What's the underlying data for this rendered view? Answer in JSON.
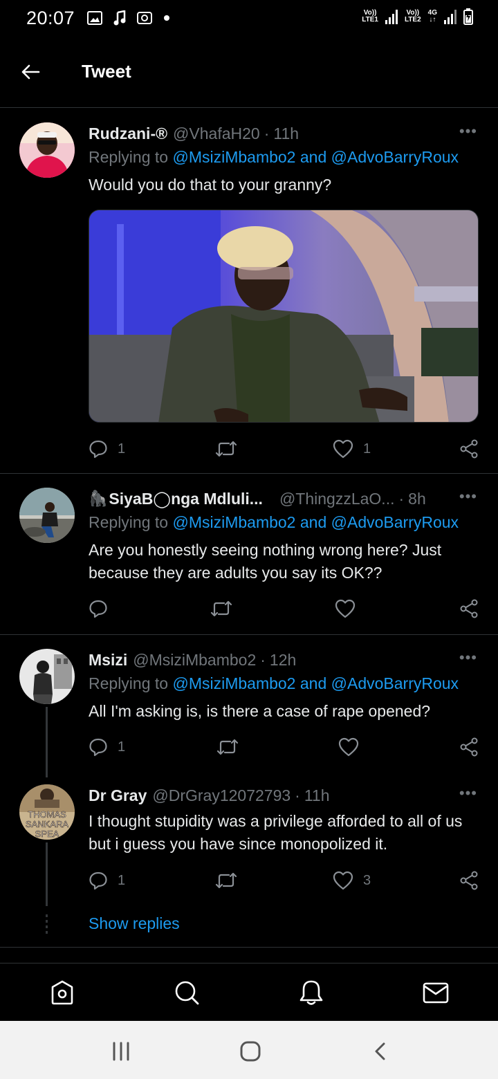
{
  "status_bar": {
    "time": "20:07",
    "sim1_label_top": "Vo))",
    "sim1_label_bottom": "LTE1",
    "sim2_label_top": "Vo))",
    "sim2_label_bottom": "LTE2",
    "network": "4G"
  },
  "header": {
    "title": "Tweet"
  },
  "tweets": [
    {
      "name": "Rudzani-®",
      "handle": "@VhafaH20",
      "time": "11h",
      "replying_prefix": "Replying to",
      "mention1": "@MsiziMbambo2",
      "and": "and",
      "mention2": "@AdvoBarryRoux",
      "text": "Would you do that to your granny?",
      "reply_count": "1",
      "retweet_count": "",
      "like_count": "1"
    },
    {
      "name": "SiyaB◯nga Mdluli...",
      "emoji": "🦍",
      "handle": "@ThingzzLaO...",
      "time": "8h",
      "replying_prefix": "Replying to",
      "mention1": "@MsiziMbambo2",
      "and": "and",
      "mention2": "@AdvoBarryRoux",
      "text": "Are you honestly seeing nothing wrong here? Just because they are adults you say its OK??",
      "reply_count": "",
      "retweet_count": "",
      "like_count": ""
    },
    {
      "name": "Msizi",
      "handle": "@MsiziMbambo2",
      "time": "12h",
      "replying_prefix": "Replying to",
      "mention1": "@MsiziMbambo2",
      "and": "and",
      "mention2": "@AdvoBarryRoux",
      "text": "All I'm asking is, is there a case of rape opened?",
      "reply_count": "1",
      "retweet_count": "",
      "like_count": ""
    },
    {
      "name": "Dr Gray",
      "handle": "@DrGray12072793",
      "time": "11h",
      "text": "I thought stupidity was a privilege afforded to all of us but i guess you have since monopolized it.",
      "avatar_text": "THOMAS SANKARA SPEA",
      "reply_count": "1",
      "retweet_count": "",
      "like_count": "3"
    }
  ],
  "show_replies": "Show replies",
  "more_glyph": "•••",
  "dot_sep": "·",
  "icons": {
    "back": "arrow-left-icon",
    "reply": "reply-bubble-icon",
    "retweet": "retweet-icon",
    "like": "heart-icon",
    "share": "share-icon",
    "home": "home-icon",
    "search": "search-icon",
    "notifications": "bell-icon",
    "messages": "mail-icon"
  },
  "colors": {
    "accent": "#1d9bf0",
    "muted": "#71767b",
    "background": "#000000"
  }
}
